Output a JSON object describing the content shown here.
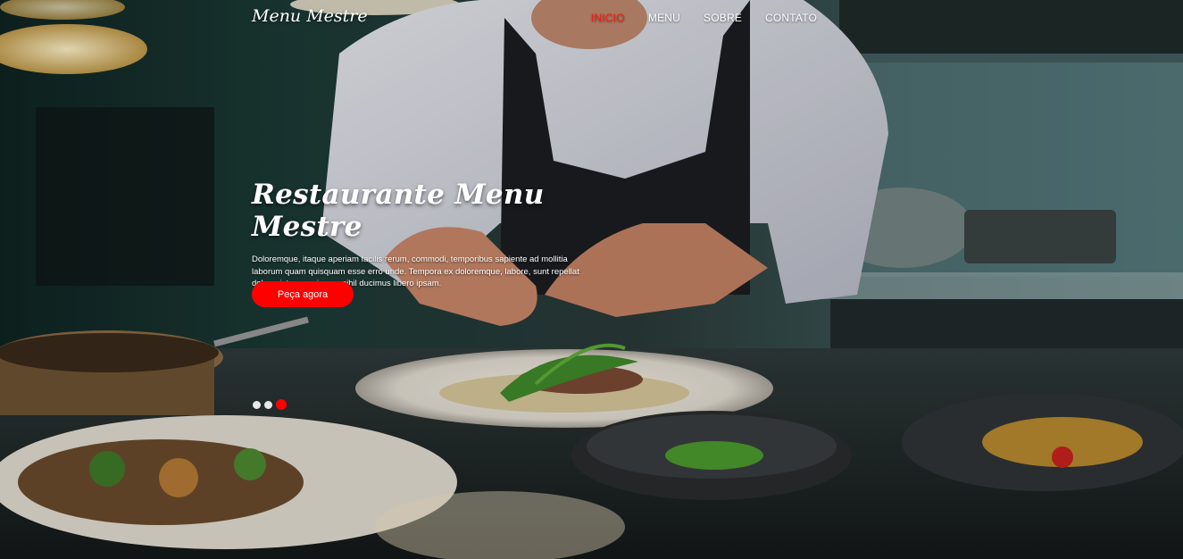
{
  "nav": {
    "brand": "Menu Mestre",
    "items": [
      {
        "label": "INICIO",
        "active": true
      },
      {
        "label": "MENU",
        "active": false
      },
      {
        "label": "SOBRE",
        "active": false
      },
      {
        "label": "CONTATO",
        "active": false
      }
    ]
  },
  "hero": {
    "title": "Restaurante Menu Mestre",
    "description": "Doloremque, itaque aperiam facilis rerum, commodi, temporibus sapiente ad mollitia laborum quam quisquam esse erro unde. Tempora ex doloremque, labore, sunt repellat dolore, iste magni quos nihil ducimus libero ipsam.",
    "cta_label": "Peça agora",
    "slides_total": 3,
    "active_slide": 3
  },
  "colors": {
    "accent": "#ff0000",
    "nav_text": "#ffffff"
  }
}
